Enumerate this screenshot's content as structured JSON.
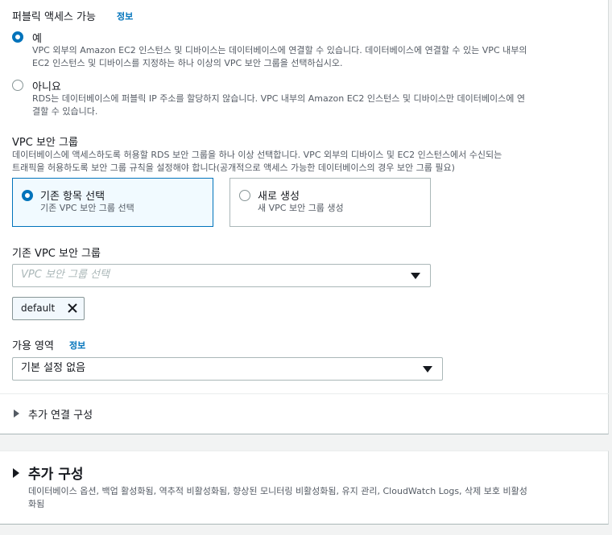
{
  "public_access": {
    "label": "퍼블릭 액세스 가능",
    "info": "정보",
    "options": [
      {
        "label": "예",
        "desc_line1": "VPC 외부의 Amazon EC2 인스턴스 및 디바이스는 데이터베이스에 연결할 수 있습니다. 데이터베이스에 연결할 수 있는 VPC 내부의",
        "desc_line2": "EC2 인스턴스 및 디바이스를 지정하는 하나 이상의 VPC 보안 그룹을 선택하십시오.",
        "selected": true
      },
      {
        "label": "아니요",
        "desc_line1": "RDS는 데이터베이스에 퍼블릭 IP 주소를 할당하지 않습니다. VPC 내부의 Amazon EC2 인스턴스 및 디바이스만 데이터베이스에 연",
        "desc_line2": "결할 수 있습니다.",
        "selected": false
      }
    ]
  },
  "vpc_security_group": {
    "label": "VPC 보안 그룹",
    "desc_line1": "데이터베이스에 액세스하도록 허용할 RDS 보안 그룹을 하나 이상 선택합니다. VPC 외부의 디바이스 및 EC2 인스턴스에서 수신되는",
    "desc_line2": "트래픽을 허용하도록 보안 그룹 규칙을 설정해야 합니다(공개적으로 액세스 가능한 데이터베이스의 경우 보안 그룹 필요)",
    "tiles": [
      {
        "title": "기존 항목 선택",
        "subtitle": "기존 VPC 보안 그룹 선택",
        "selected": true
      },
      {
        "title": "새로 생성",
        "subtitle": "새 VPC 보안 그룹 생성",
        "selected": false
      }
    ]
  },
  "existing_vpc_sg": {
    "label": "기존 VPC 보안 그룹",
    "placeholder": "VPC 보안 그룹 선택",
    "tokens": [
      "default"
    ]
  },
  "availability_zone": {
    "label": "가용 영역",
    "info": "정보",
    "value": "기본 설정 없음"
  },
  "additional_connection": {
    "label": "추가 연결 구성"
  },
  "additional_config": {
    "title": "추가 구성",
    "desc_line1": "데이터베이스 옵션, 백업 활성화됨, 역추적 비활성화됨, 향상된 모니터링 비활성화됨, 유지 관리, CloudWatch Logs, 삭제 보호 비활성",
    "desc_line2": "화됨"
  },
  "colors": {
    "accent": "#0073bb",
    "text": "#16191f",
    "muted": "#545b64",
    "border": "#aab7b8",
    "page_bg": "#f2f3f3"
  }
}
